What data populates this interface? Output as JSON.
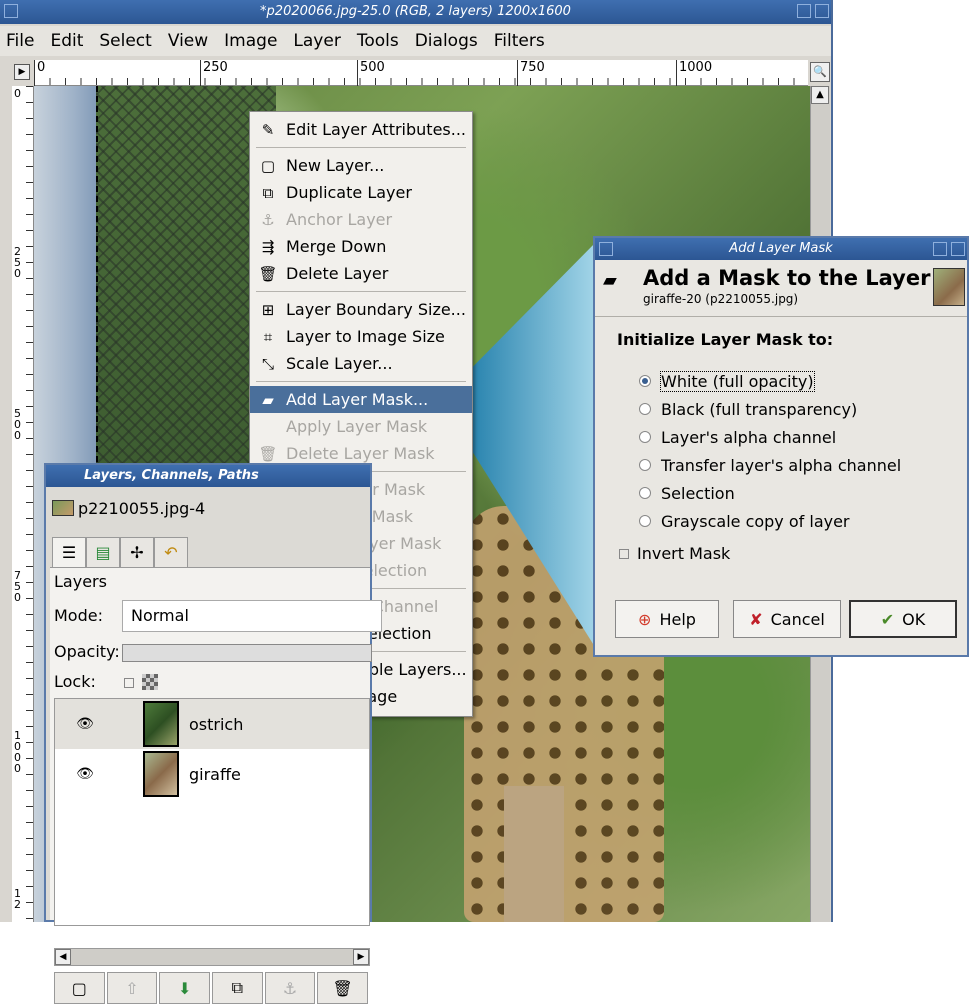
{
  "window": {
    "title": "*p2020066.jpg-25.0 (RGB, 2 layers) 1200x1600",
    "menu": [
      "File",
      "Edit",
      "Select",
      "View",
      "Image",
      "Layer",
      "Tools",
      "Dialogs",
      "Filters"
    ],
    "ruler_top": [
      "0",
      "250",
      "500",
      "750",
      "1000"
    ],
    "ruler_left": [
      "0",
      "250",
      "500",
      "750",
      "1000",
      "12"
    ]
  },
  "context_menu": {
    "items": [
      {
        "label": "Edit Layer Attributes...",
        "icon": "edit-icon",
        "glyph": "✎",
        "disabled": false
      },
      {
        "sep": true
      },
      {
        "label": "New Layer...",
        "icon": "new-layer-icon",
        "glyph": "▢",
        "disabled": false
      },
      {
        "label": "Duplicate Layer",
        "icon": "duplicate-icon",
        "glyph": "⧉",
        "disabled": false
      },
      {
        "label": "Anchor Layer",
        "icon": "anchor-icon",
        "glyph": "⚓",
        "disabled": true
      },
      {
        "label": "Merge Down",
        "icon": "merge-down-icon",
        "glyph": "⇶",
        "disabled": false
      },
      {
        "label": "Delete Layer",
        "icon": "delete-icon",
        "glyph": "🗑",
        "disabled": false
      },
      {
        "sep": true
      },
      {
        "label": "Layer Boundary Size...",
        "icon": "boundary-icon",
        "glyph": "⊞",
        "disabled": false
      },
      {
        "label": "Layer to Image Size",
        "icon": "to-image-size-icon",
        "glyph": "⌗",
        "disabled": false
      },
      {
        "label": "Scale Layer...",
        "icon": "scale-icon",
        "glyph": "⤡",
        "disabled": false
      },
      {
        "sep": true
      },
      {
        "label": "Add Layer Mask...",
        "icon": "add-mask-icon",
        "glyph": "▰",
        "disabled": false,
        "selected": true
      },
      {
        "label": "Apply Layer Mask",
        "icon": "",
        "glyph": "",
        "disabled": true
      },
      {
        "label": "Delete Layer Mask",
        "icon": "delete-icon",
        "glyph": "🗑",
        "disabled": true
      },
      {
        "sep": true
      },
      {
        "label": "Show Layer Mask",
        "icon": "checkbox-icon",
        "glyph": "chk",
        "disabled": true
      },
      {
        "label": "Edit Layer Mask",
        "icon": "checkbox-icon",
        "glyph": "chk",
        "disabled": true
      },
      {
        "label": "Disable Layer Mask",
        "icon": "checkbox-icon",
        "glyph": "chk",
        "disabled": true
      },
      {
        "label": "Mask to Selection",
        "icon": "mask-selection-icon",
        "glyph": "swgray",
        "disabled": true
      },
      {
        "sep": true
      },
      {
        "label": "Add Alpha Channel",
        "icon": "alpha-icon",
        "glyph": "swchecker",
        "disabled": true
      },
      {
        "label": "Alpha to Selection",
        "icon": "alpha-selection-icon",
        "glyph": "swred",
        "disabled": false
      },
      {
        "sep": true
      },
      {
        "label": "Merge Visible Layers...",
        "icon": "",
        "glyph": "",
        "disabled": false
      },
      {
        "label": "Flatten Image",
        "icon": "",
        "glyph": "",
        "disabled": false
      }
    ]
  },
  "layers_panel": {
    "title": "Layers, Channels, Paths",
    "image_name": "p2210055.jpg-4",
    "section": "Layers",
    "mode_label": "Mode:",
    "mode_value": "Normal",
    "opacity_label": "Opacity:",
    "lock_label": "Lock:",
    "layers": [
      {
        "name": "ostrich",
        "visible": true,
        "active": false
      },
      {
        "name": "giraffe",
        "visible": true,
        "active": false
      }
    ]
  },
  "dialog": {
    "title": "Add Layer Mask",
    "heading": "Add a Mask to the Layer",
    "subheading": "giraffe-20 (p2210055.jpg)",
    "section_label": "Initialize Layer Mask to:",
    "options": [
      {
        "label": "White (full opacity)",
        "checked": true
      },
      {
        "label": "Black (full transparency)",
        "checked": false
      },
      {
        "label": "Layer's alpha channel",
        "checked": false
      },
      {
        "label": "Transfer layer's alpha channel",
        "checked": false
      },
      {
        "label": "Selection",
        "checked": false
      },
      {
        "label": "Grayscale copy of layer",
        "checked": false
      }
    ],
    "invert_label": "Invert Mask",
    "invert_checked": false,
    "buttons": {
      "help": "Help",
      "cancel": "Cancel",
      "ok": "OK"
    }
  },
  "colors": {
    "titlebar": "#2c5693",
    "menu_highlight": "#4a6f9b",
    "callout": "#1a7fb0",
    "alpha_swatch": "#e05050"
  }
}
